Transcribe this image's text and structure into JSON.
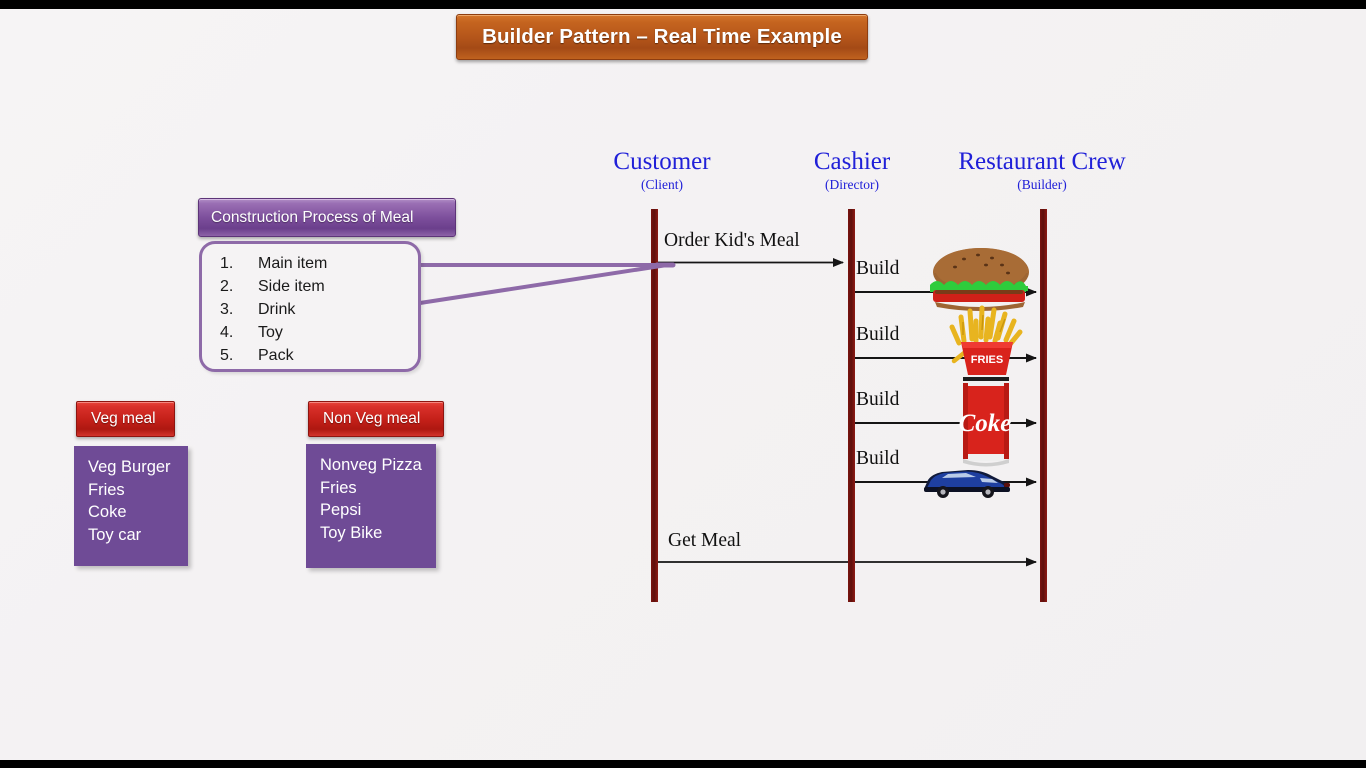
{
  "slide": {
    "title": "Builder Pattern – Real Time Example",
    "background_color": "#f4f2f3",
    "letterbox_color": "#000000",
    "accent_title_color": "#b4551a"
  },
  "callout": {
    "header": "Construction Process of Meal",
    "header_color": "#7d4f9c",
    "border_color": "#8e6aa8",
    "steps": [
      {
        "num": "1.",
        "label": "Main item"
      },
      {
        "num": "2.",
        "label": "Side item"
      },
      {
        "num": "3.",
        "label": "Drink"
      },
      {
        "num": "4.",
        "label": "Toy"
      },
      {
        "num": "5.",
        "label": "Pack"
      }
    ]
  },
  "meals": [
    {
      "id": "veg",
      "header": "Veg meal",
      "header_color": "#c42019",
      "panel_color": "#6f4b96",
      "items": [
        "Veg Burger",
        "Fries",
        "Coke",
        "Toy car"
      ]
    },
    {
      "id": "nonveg",
      "header": "Non Veg meal",
      "header_color": "#c42019",
      "panel_color": "#6f4b96",
      "items": [
        "Nonveg Pizza",
        "Fries",
        "Pepsi",
        "Toy Bike"
      ]
    }
  ],
  "sequence": {
    "lifeline_color": "#6e120e",
    "actor_text_color": "#2020d8",
    "actors": [
      {
        "name": "Customer",
        "role": "(Client)"
      },
      {
        "name": "Cashier",
        "role": "(Director)"
      },
      {
        "name": "Restaurant Crew",
        "role": "(Builder)"
      }
    ],
    "messages": [
      {
        "label": "Order Kid's Meal",
        "from": "Customer",
        "to": "Cashier"
      },
      {
        "label": "Build",
        "from": "Cashier",
        "to": "Restaurant Crew",
        "artifact": "burger"
      },
      {
        "label": "Build",
        "from": "Cashier",
        "to": "Restaurant Crew",
        "artifact": "fries"
      },
      {
        "label": "Build",
        "from": "Cashier",
        "to": "Restaurant Crew",
        "artifact": "coke-can"
      },
      {
        "label": "Build",
        "from": "Cashier",
        "to": "Restaurant Crew",
        "artifact": "toy-car"
      },
      {
        "label": "Get Meal",
        "from": "Customer",
        "to": "Restaurant Crew"
      }
    ],
    "artifact_labels": {
      "fries_can_text": "FRIES",
      "coke_can_text": "Coke"
    }
  }
}
